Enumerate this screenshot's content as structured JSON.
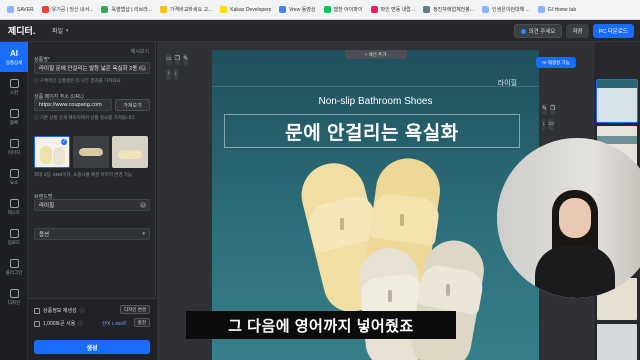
{
  "bookmarks": [
    "SAVER",
    "유기공 | 당신 내서...",
    "육셀랩샵 | 리브라...",
    "가격비교하세요 고...",
    "Kakao Developers",
    "Vrew 동영상",
    "햄찬 아이파이",
    "파인 변동 내랍...",
    "청진자에업체전봉...",
    "인생은이런대해 ...",
    "GI Home tab"
  ],
  "app": {
    "logo": "제디터.",
    "file_menu": "파일",
    "feedback_label": "의견 주세요",
    "save_label": "저장",
    "download_label": "PC 다운로드"
  },
  "rail": [
    {
      "icon": "ai-icon",
      "label": "상품상세"
    },
    {
      "icon": "template-icon",
      "label": "스킨"
    },
    {
      "icon": "block-icon",
      "label": "블록"
    },
    {
      "icon": "image-icon",
      "label": "이미지"
    },
    {
      "icon": "element-icon",
      "label": "요소"
    },
    {
      "icon": "text-icon",
      "label": "텍스트"
    },
    {
      "icon": "upload-icon",
      "label": "업로드"
    },
    {
      "icon": "more-icon",
      "label": "플러그인"
    },
    {
      "icon": "design-icon",
      "label": "디자인"
    }
  ],
  "panel": {
    "top_link": "예시보기",
    "product_name_label": "상품명*",
    "product_name_value": "라이힐 문에 안걸리는 발등 넓은 욕실화 2종 / ...",
    "product_name_hint": "ⓘ 구체적인 상품명은 더 나은 결과를 가져와요.",
    "url_label": "상품 페이지 주소 (URL)",
    "url_value": "https://www.coupang.com",
    "import_label": "가져오기",
    "url_hint": "ⓘ 기존 상품 상세 페이지에서 상품 정보를 가져옵니다.",
    "image_hint": "최대 3장, SMB이하, 쇼핑시몰 배경 이미지 변경 가능",
    "brand_label": "브랜드명",
    "brand_value": "라이힐",
    "option_label": "옵션",
    "regen_label": "상품정보 재생성",
    "design_only_label": "디자인 변경",
    "tokens_label": "1,000토큰 사용",
    "tokens_hint": "ⓘ",
    "remaining_label": "잔여 1,900토",
    "charge_label": "충전",
    "generate_label": "생성"
  },
  "canvas": {
    "add_section_label": "+ 섹션 추가",
    "brand_text": "라이힐",
    "english_title": "Non-slip Bathroom Shoes",
    "korean_title": "문에 안걸리는 욕실화"
  },
  "ai_badge": "AI 재생성 가능",
  "subtitle": "그 다음에 영어까지 넣어줬죠",
  "colors": {
    "accent": "#1a6cff",
    "canvas_bg": "#2d6e7b",
    "slipper_yellow": "#f1dea3",
    "slipper_beige": "#e6e1d2"
  }
}
